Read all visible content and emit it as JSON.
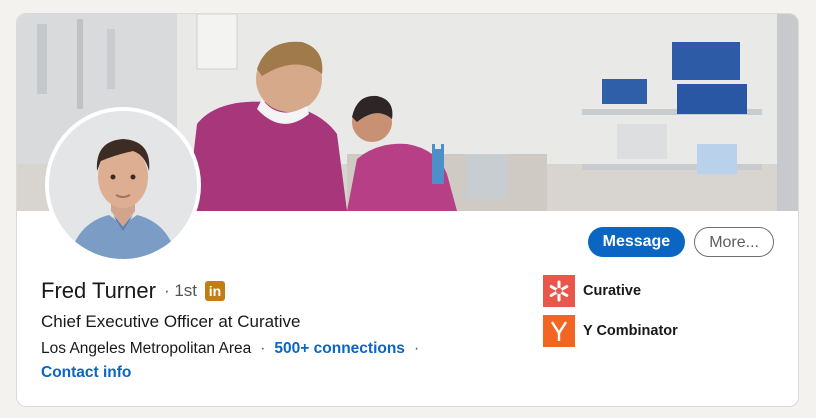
{
  "profile": {
    "name": "Fred Turner",
    "degree": "1st",
    "headline": "Chief Executive Officer at Curative",
    "location": "Los Angeles Metropolitan Area",
    "connections": "500+ connections",
    "contact_info": "Contact info",
    "separator": "·"
  },
  "actions": {
    "message_label": "Message",
    "more_label": "More..."
  },
  "organizations": [
    {
      "name": "Curative",
      "logo": "curative-logo",
      "color": "#e8574a"
    },
    {
      "name": "Y Combinator",
      "logo": "y-combinator-logo",
      "color": "#f26522"
    }
  ],
  "badge": {
    "text": "in",
    "color": "#c37d16"
  },
  "colors": {
    "accent": "#0a66c2",
    "background": "#f3f2ef"
  }
}
